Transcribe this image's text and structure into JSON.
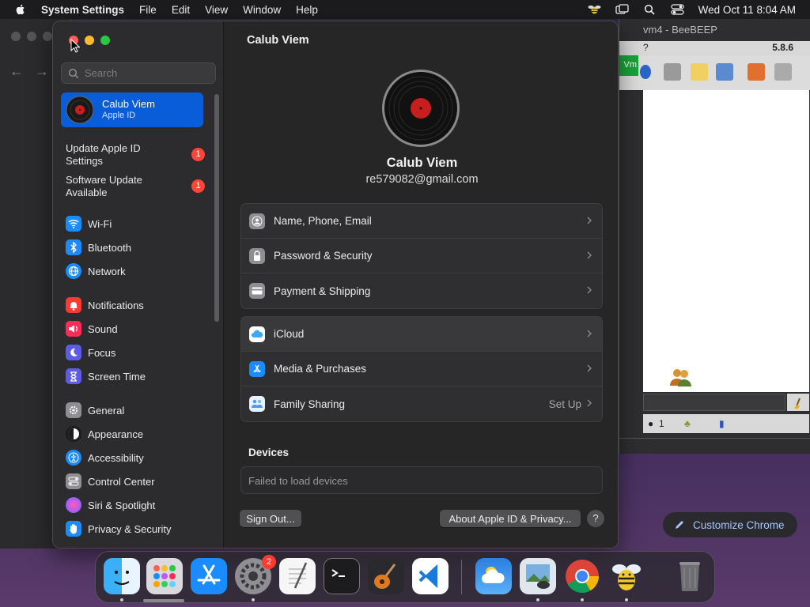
{
  "menubar": {
    "app_name": "System Settings",
    "menus": [
      "File",
      "Edit",
      "View",
      "Window",
      "Help"
    ],
    "clock": "Wed Oct 11  8:04 AM"
  },
  "beebeep": {
    "title": "vm4 - BeeBEEP",
    "version": "5.8.6",
    "question": "?",
    "green_tag": "Vm",
    "status_count": "1"
  },
  "chrome": {
    "customize_label": "Customize Chrome"
  },
  "sidebar": {
    "search_placeholder": "Search",
    "account": {
      "name": "Calub Viem",
      "subtitle": "Apple ID"
    },
    "notices": [
      {
        "label": "Update Apple ID Settings",
        "badge": "1"
      },
      {
        "label": "Software Update Available",
        "badge": "1"
      }
    ],
    "items": [
      {
        "label": "Wi-Fi",
        "icon": "wifi-icon",
        "color": "#1a8cff"
      },
      {
        "label": "Bluetooth",
        "icon": "bluetooth-icon",
        "color": "#1a8cff"
      },
      {
        "label": "Network",
        "icon": "globe-icon",
        "color": "#1a8cff"
      },
      {
        "label": "Notifications",
        "icon": "bell-icon",
        "color": "#ff3b30"
      },
      {
        "label": "Sound",
        "icon": "speaker-icon",
        "color": "#ff2d55"
      },
      {
        "label": "Focus",
        "icon": "moon-icon",
        "color": "#5e5ce6"
      },
      {
        "label": "Screen Time",
        "icon": "hourglass-icon",
        "color": "#5e5ce6"
      },
      {
        "label": "General",
        "icon": "gear-icon",
        "color": "#8e8e93"
      },
      {
        "label": "Appearance",
        "icon": "appearance-icon",
        "color": "#1c1c1e"
      },
      {
        "label": "Accessibility",
        "icon": "accessibility-icon",
        "color": "#1a8cff"
      },
      {
        "label": "Control Center",
        "icon": "control-center-icon",
        "color": "#8e8e93"
      },
      {
        "label": "Siri & Spotlight",
        "icon": "siri-icon",
        "color": "#bf5af2"
      },
      {
        "label": "Privacy & Security",
        "icon": "hand-icon",
        "color": "#1a8cff"
      }
    ]
  },
  "main": {
    "title": "Calub Viem",
    "profile_name": "Calub Viem",
    "profile_email": "re579082@gmail.com",
    "group1": [
      {
        "label": "Name, Phone, Email",
        "icon": "contact-icon"
      },
      {
        "label": "Password & Security",
        "icon": "lock-icon"
      },
      {
        "label": "Payment & Shipping",
        "icon": "card-icon"
      }
    ],
    "group2": [
      {
        "label": "iCloud",
        "icon": "icloud-icon",
        "extra": ""
      },
      {
        "label": "Media & Purchases",
        "icon": "app-store-icon",
        "extra": ""
      },
      {
        "label": "Family Sharing",
        "icon": "family-icon",
        "extra": "Set Up"
      }
    ],
    "devices_heading": "Devices",
    "devices_message": "Failed to load devices",
    "sign_out_label": "Sign Out...",
    "about_label": "About Apple ID & Privacy...",
    "help_label": "?"
  },
  "dock": {
    "apps": [
      "Finder",
      "Launchpad",
      "App Store",
      "System Settings",
      "TextEdit",
      "Terminal",
      "GarageBand",
      "Visual Studio Code",
      "Weather",
      "Preview",
      "Google Chrome",
      "BeeBEEP",
      "Trash"
    ],
    "settings_badge": "2"
  }
}
